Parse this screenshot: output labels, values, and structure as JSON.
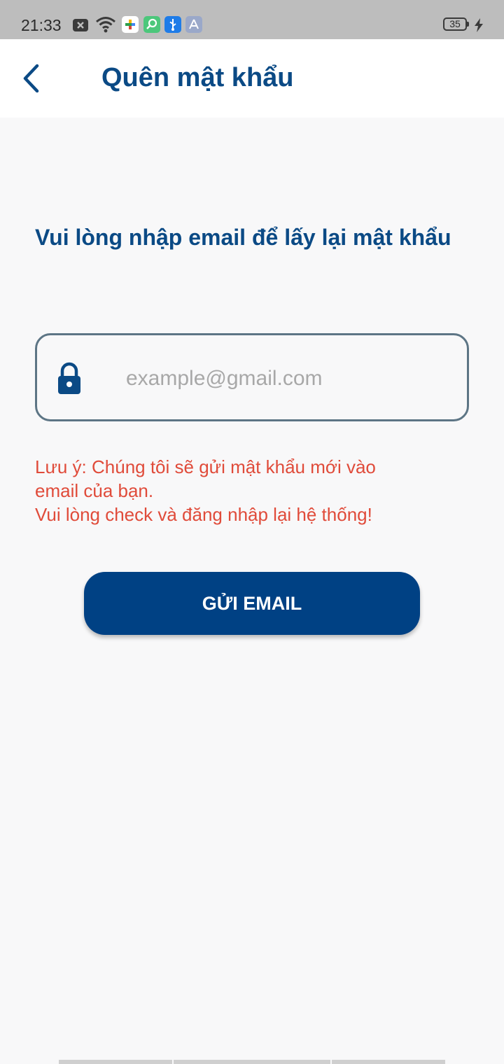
{
  "status_bar": {
    "time": "21:33",
    "battery": "35",
    "icons": [
      "notification-x-icon",
      "wifi-icon",
      "app-store-icon",
      "search-app-icon",
      "usb-icon",
      "tools-icon",
      "charging-icon"
    ]
  },
  "header": {
    "back_icon": "chevron-left-icon",
    "title": "Quên mật khẩu"
  },
  "form": {
    "instruction": "Vui lòng nhập email để lấy lại mật khẩu",
    "email": {
      "icon": "lock-icon",
      "placeholder": "example@gmail.com",
      "value": ""
    },
    "note_lines": [
      "Lưu ý: Chúng tôi sẽ gửi mật khẩu mới vào",
      "email của bạn.",
      "Vui lòng check và đăng nhập lại hệ thống!"
    ],
    "submit_label": "GỬI EMAIL"
  },
  "colors": {
    "primary": "#0b4a85",
    "button": "#004184",
    "warning": "#e04b3a",
    "border": "#5d7585",
    "background": "#f8f8f9"
  }
}
